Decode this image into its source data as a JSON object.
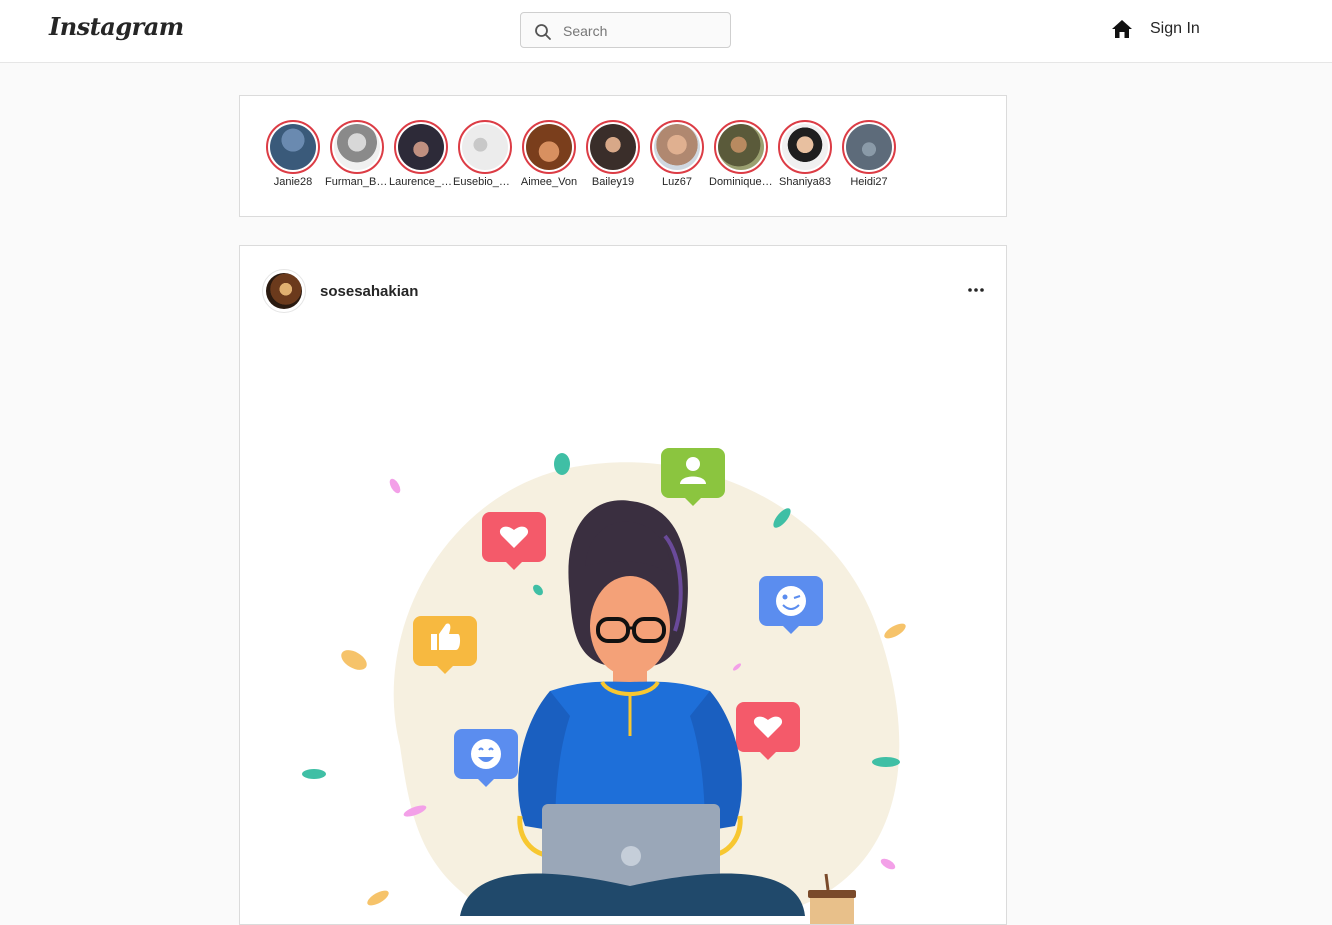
{
  "header": {
    "logo": "Instagram",
    "search_placeholder": "Search",
    "signin_label": "Sign In"
  },
  "stories": [
    {
      "username": "Janie28",
      "color": "#3a5a7a"
    },
    {
      "username": "Furman_Brown",
      "color": "#8a8a8a"
    },
    {
      "username": "Laurence_Kris",
      "color": "#2d2a38"
    },
    {
      "username": "Eusebio_Bednar",
      "color": "#e6e6e6"
    },
    {
      "username": "Aimee_Von",
      "color": "#7a3e1c"
    },
    {
      "username": "Bailey19",
      "color": "#3a2e2a"
    },
    {
      "username": "Luz67",
      "color": "#b08870"
    },
    {
      "username": "Dominique_Hyatt",
      "color": "#5a5a3a"
    },
    {
      "username": "Shaniya83",
      "color": "#1f1f1f"
    },
    {
      "username": "Heidi27",
      "color": "#5d6b7a"
    }
  ],
  "post": {
    "username": "sosesahakian"
  }
}
